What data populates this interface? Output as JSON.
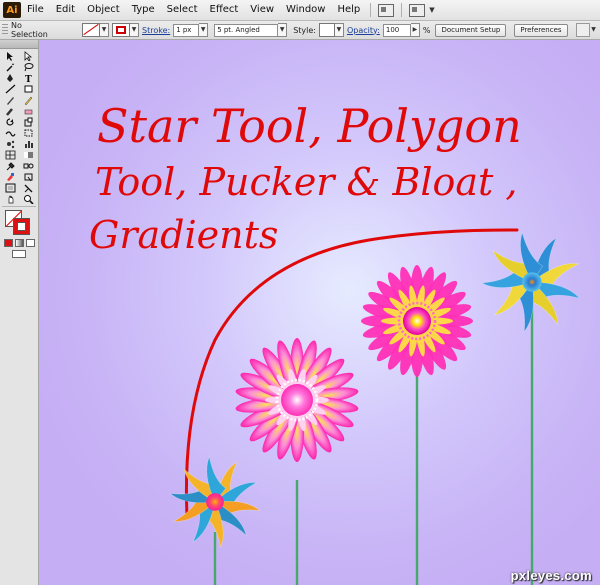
{
  "app": {
    "logo": "Ai"
  },
  "menu": {
    "items": [
      "File",
      "Edit",
      "Object",
      "Type",
      "Select",
      "Effect",
      "View",
      "Window",
      "Help"
    ]
  },
  "control_bar": {
    "selection_label": "No Selection",
    "stroke_label": "Stroke:",
    "stroke_weight": "1 px",
    "brush": "5 pt. Angled",
    "style_label": "Style:",
    "opacity_label": "Opacity:",
    "opacity_value": "100",
    "opacity_unit": "%",
    "document_setup_button": "Document Setup",
    "preferences_button": "Preferences"
  },
  "tools": {
    "icons": [
      "selection-arrow-icon",
      "direct-selection-icon",
      "magic-wand-icon",
      "lasso-icon",
      "pen-icon",
      "type-icon",
      "line-segment-icon",
      "rectangle-icon",
      "paintbrush-icon",
      "pencil-icon",
      "blob-brush-icon",
      "eraser-icon",
      "rotate-icon",
      "scale-icon",
      "warp-icon",
      "free-transform-icon",
      "symbol-sprayer-icon",
      "column-graph-icon",
      "mesh-icon",
      "gradient-icon",
      "eyedropper-icon",
      "blend-icon",
      "live-paint-icon",
      "live-paint-select-icon",
      "artboard-icon",
      "slice-icon",
      "hand-icon",
      "zoom-icon"
    ],
    "fill_color": "none",
    "stroke_color": "#d11111"
  },
  "artwork": {
    "caption_lines": [
      "Star Tool, Polygon",
      "Tool, Pucker & Bloat ,",
      "Gradients"
    ],
    "caption_color": "#e00909",
    "watermark": "pxleyes.com"
  }
}
